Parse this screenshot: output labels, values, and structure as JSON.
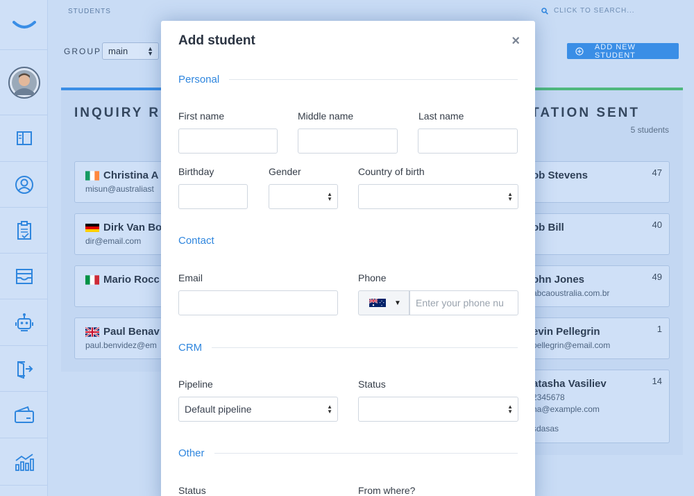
{
  "header": {
    "breadcrumb": "STUDENTS",
    "search_placeholder": "CLICK TO SEARCH...",
    "group_label": "GROUP",
    "group_value": "main",
    "add_button_label": "ADD NEW STUDENT"
  },
  "sidebar": {
    "items": [
      {
        "icon": "logo-smile-icon"
      },
      {
        "icon": "avatar"
      },
      {
        "icon": "book-icon"
      },
      {
        "icon": "user-circle-icon"
      },
      {
        "icon": "clipboard-check-icon"
      },
      {
        "icon": "inbox-icon"
      },
      {
        "icon": "robot-icon"
      },
      {
        "icon": "exit-door-icon"
      },
      {
        "icon": "wallet-icon"
      },
      {
        "icon": "chart-bars-icon"
      }
    ]
  },
  "columns": {
    "left": {
      "title": "INQUIRY R",
      "cards": [
        {
          "name": "Christina A",
          "email": "misun@australiast",
          "flag": "ireland"
        },
        {
          "name": "Dirk Van Bo",
          "email": "dir@email.com",
          "flag": "germany"
        },
        {
          "name": "Mario Rocc",
          "email": "",
          "flag": "italy"
        },
        {
          "name": "Paul Benav",
          "email": "paul.benvidez@em",
          "flag": "uk"
        }
      ]
    },
    "right": {
      "title": "TATION SENT",
      "count": "5 students",
      "cards": [
        {
          "name": "ob Stevens",
          "email": "",
          "score": "47"
        },
        {
          "name": "ob Bill",
          "email": "",
          "score": "40"
        },
        {
          "name": "ohn Jones",
          "email": "abcaoustralia.com.br",
          "score": "49"
        },
        {
          "name": "evin Pellegrin",
          "email": "pellegrin@email.com",
          "score": "1"
        },
        {
          "name": "atasha Vasiliev",
          "email": "2345678",
          "extra": "ha@example.com",
          "note": "sdasas",
          "score": "14"
        }
      ]
    }
  },
  "modal": {
    "title": "Add student",
    "close": "×",
    "sections": {
      "personal": "Personal",
      "contact": "Contact",
      "crm": "CRM",
      "other": "Other"
    },
    "labels": {
      "first_name": "First name",
      "middle_name": "Middle name",
      "last_name": "Last name",
      "birthday": "Birthday",
      "gender": "Gender",
      "country": "Country of birth",
      "email": "Email",
      "phone": "Phone",
      "pipeline": "Pipeline",
      "status": "Status",
      "other_status": "Status",
      "from_where": "From where?"
    },
    "values": {
      "phone_placeholder": "Enter your phone nu",
      "pipeline": "Default pipeline"
    }
  }
}
